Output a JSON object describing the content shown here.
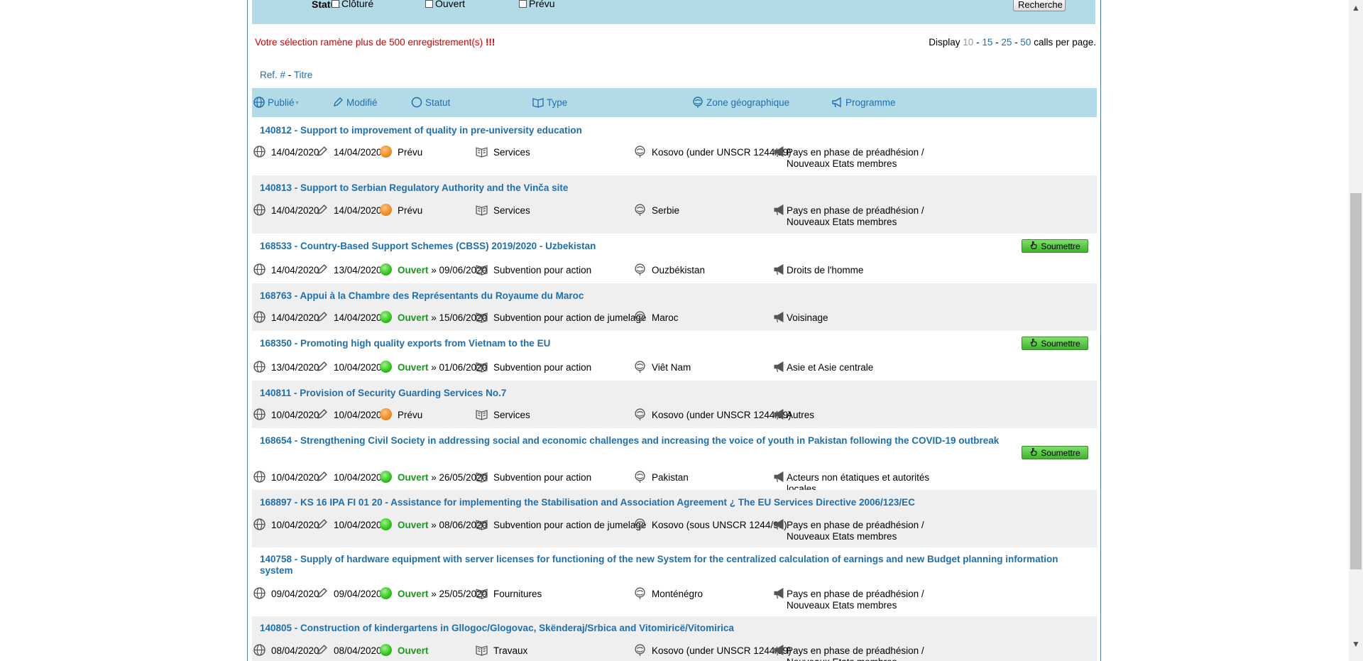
{
  "filters": {
    "statut_label": "Statut",
    "checkboxes": [
      "Clôturé",
      "Ouvert",
      "Prévu"
    ],
    "search_button": "Recherche"
  },
  "warning": {
    "text": "Votre sélection ramène plus de 500 enregistrement(s) ",
    "emphasis": "!!!"
  },
  "pagination": {
    "prefix": "Display",
    "current": "10",
    "options": [
      "15",
      "25",
      "50"
    ],
    "suffix": "calls per page."
  },
  "sort": {
    "ref": "Ref. #",
    "separator": "-",
    "title": "Titre"
  },
  "columns": {
    "published": "Publié",
    "modified": "Modifié",
    "status": "Statut",
    "type": "Type",
    "zone": "Zone géographique",
    "programme": "Programme"
  },
  "submit_label": "Soumettre",
  "rows": [
    {
      "title": "140812 - Support to improvement of quality in pre-university education",
      "published": "14/04/2020",
      "modified": "14/04/2020",
      "status": "Prévu",
      "deadline": "",
      "type": "Services",
      "zone": "Kosovo (under UNSCR 1244/99)",
      "programme": "Pays en phase de préadhésion / Nouveaux Etats membres",
      "submit": false
    },
    {
      "title": "140813 - Support to Serbian Regulatory Authority and the Vinča site",
      "published": "14/04/2020",
      "modified": "14/04/2020",
      "status": "Prévu",
      "deadline": "",
      "type": "Services",
      "zone": "Serbie",
      "programme": "Pays en phase de préadhésion / Nouveaux Etats membres",
      "submit": false
    },
    {
      "title": "168533 - Country-Based Support Schemes (CBSS) 2019/2020 - Uzbekistan",
      "published": "14/04/2020",
      "modified": "13/04/2020",
      "status": "Ouvert",
      "deadline": "09/06/2020",
      "type": "Subvention pour action",
      "zone": "Ouzbékistan",
      "programme": "Droits de l'homme",
      "submit": true
    },
    {
      "title": "168763 - Appui à la Chambre des Représentants du Royaume du Maroc",
      "published": "14/04/2020",
      "modified": "14/04/2020",
      "status": "Ouvert",
      "deadline": "15/06/2020",
      "type": "Subvention pour action de jumelage",
      "zone": "Maroc",
      "programme": "Voisinage",
      "submit": false
    },
    {
      "title": "168350 - Promoting high quality exports from Vietnam to the EU",
      "published": "13/04/2020",
      "modified": "10/04/2020",
      "status": "Ouvert",
      "deadline": "01/06/2020",
      "type": "Subvention pour action",
      "zone": "Viêt Nam",
      "programme": "Asie et Asie centrale",
      "submit": true
    },
    {
      "title": "140811 - Provision of Security Guarding Services No.7",
      "published": "10/04/2020",
      "modified": "10/04/2020",
      "status": "Prévu",
      "deadline": "",
      "type": "Services",
      "zone": "Kosovo (under UNSCR 1244/99)",
      "programme": "Autres",
      "submit": false
    },
    {
      "title": "168654 - Strengthening Civil Society in addressing social and economic challenges and increasing the voice of youth in Pakistan following the COVID-19 outbreak",
      "published": "10/04/2020",
      "modified": "10/04/2020",
      "status": "Ouvert",
      "deadline": "26/05/2020",
      "type": "Subvention pour action",
      "zone": "Pakistan",
      "programme": "Acteurs non étatiques et autorités locales",
      "submit": true
    },
    {
      "title": "168897 - KS 16 IPA FI 01 20 - Assistance for implementing the Stabilisation and Association Agreement ¿ The EU Services Directive 2006/123/EC",
      "published": "10/04/2020",
      "modified": "10/04/2020",
      "status": "Ouvert",
      "deadline": "08/06/2020",
      "type": "Subvention pour action de jumelage",
      "zone": "Kosovo (sous UNSCR 1244/99)",
      "programme": "Pays en phase de préadhésion / Nouveaux Etats membres",
      "submit": false
    },
    {
      "title": "140758 - Supply of hardware equipment with server licenses for functioning of the new System for the centralized calculation of earnings and new Budget planning information system",
      "published": "09/04/2020",
      "modified": "09/04/2020",
      "status": "Ouvert",
      "deadline": "25/05/2020",
      "type": "Fournitures",
      "zone": "Monténégro",
      "programme": "Pays en phase de préadhésion / Nouveaux Etats membres",
      "submit": false
    },
    {
      "title": "140805 - Construction of kindergartens in Gllogoc/Glogovac, Skënderaj/Srbica and Vitomiricë/Vitomirica",
      "published": "08/04/2020",
      "modified": "08/04/2020",
      "status": "Ouvert",
      "deadline": "",
      "type": "Travaux",
      "zone": "Kosovo (under UNSCR 1244/99)",
      "programme": "Pays en phase de préadhésion / Nouveaux Etats membres",
      "submit": false
    }
  ]
}
